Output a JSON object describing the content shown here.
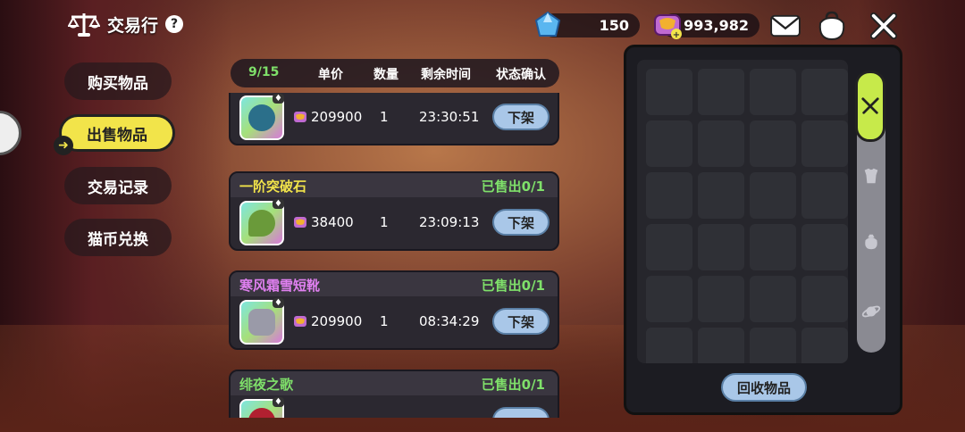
{
  "header": {
    "title": "交易行",
    "help": "?"
  },
  "currency": {
    "gems": "150",
    "coins": "993,982"
  },
  "nav": {
    "buy": "购买物品",
    "sell": "出售物品",
    "records": "交易记录",
    "exchange": "猫币兑换"
  },
  "list_header": {
    "count": "9/15",
    "price": "单价",
    "quantity": "数量",
    "remaining": "剩余时间",
    "status": "状态确认"
  },
  "listings": [
    {
      "name": "",
      "status": "",
      "price": "209900",
      "qty": "1",
      "time": "23:30:51",
      "button": "下架",
      "thumb_color": "#2b6f8a"
    },
    {
      "name": "一阶突破石",
      "status": "已售出0/1",
      "price": "38400",
      "qty": "1",
      "time": "23:09:13",
      "button": "下架",
      "thumb_color": "#6a9a3a"
    },
    {
      "name": "寒风霜雪短靴",
      "status": "已售出0/1",
      "price": "209900",
      "qty": "1",
      "time": "08:34:29",
      "button": "下架",
      "thumb_color": "#9a9aa8"
    },
    {
      "name": "绯夜之歌",
      "status": "已售出0/1",
      "price": "",
      "qty": "",
      "time": "",
      "button": "",
      "thumb_color": "#b02030"
    }
  ],
  "inventory": {
    "recycle": "回收物品"
  },
  "colors": {
    "accent_yellow": "#f2e44a",
    "status_green": "#7fe06a",
    "button_blue": "#a9c7e8",
    "tab_green": "#c7ea4a"
  }
}
